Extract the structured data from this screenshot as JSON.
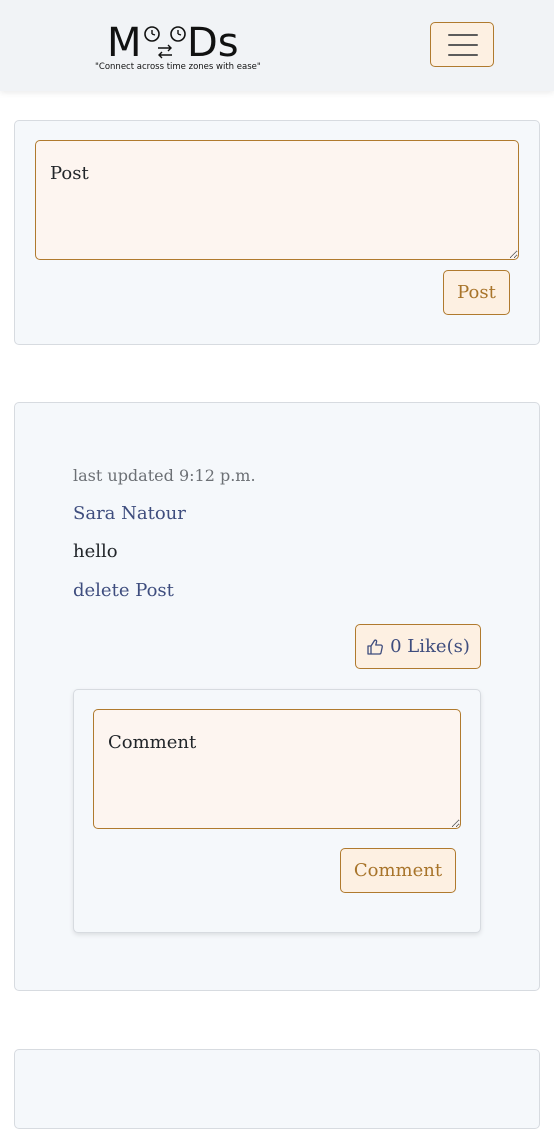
{
  "header": {
    "logo": {
      "wordmark_left": "M",
      "wordmark_right": "Ds",
      "tagline": "\"Connect across time zones with ease\""
    },
    "menu_icon": "hamburger-icon"
  },
  "composer": {
    "placeholder": "Post",
    "submit_label": "Post"
  },
  "posts": [
    {
      "last_updated": "last updated 9:12 p.m.",
      "author": "Sara Natour",
      "content": "hello",
      "delete_label": "delete Post",
      "like_icon": "thumbs-up-icon",
      "like_label": "0 Like(s)",
      "comment_placeholder": "Comment",
      "comment_submit_label": "Comment"
    }
  ],
  "colors": {
    "accent_border": "#b07a2e",
    "accent_text": "#a8742a",
    "link": "#3e4d7e",
    "button_bg": "#fdf0e2",
    "card_bg": "#f5f8fb",
    "navbar_bg": "#f1f3f6"
  }
}
